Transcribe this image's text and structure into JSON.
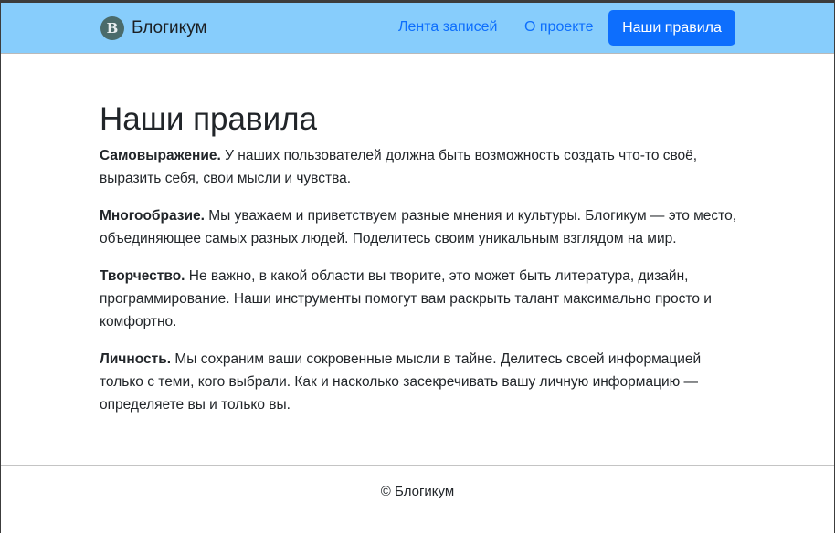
{
  "header": {
    "brand_letter": "B",
    "brand_name": "Блогикум",
    "nav": {
      "feed": "Лента записей",
      "about": "О проекте",
      "rules": "Наши правила"
    },
    "colors": {
      "navbar_bg": "#87cdfc",
      "accent": "#0d6efd"
    }
  },
  "main": {
    "title": "Наши правила",
    "rules": [
      {
        "term": "Самовыражение.",
        "text": " У наших пользователей должна быть возможность создать что-то своё, выразить себя, свои мысли и чувства."
      },
      {
        "term": "Многообразие.",
        "text": " Мы уважаем и приветствуем разные мнения и культуры. Блогикум — это место, объединяющее самых разных людей. Поделитесь своим уникальным взглядом на мир."
      },
      {
        "term": "Творчество.",
        "text": " Не важно, в какой области вы творите, это может быть литература, дизайн, программирование. Наши инструменты помогут вам раскрыть талант максимально просто и комфортно."
      },
      {
        "term": "Личность.",
        "text": " Мы сохраним ваши сокровенные мысли в тайне. Делитесь своей информацией только с теми, кого выбрали. Как и насколько засекречивать вашу личную информацию — определяете вы и только вы."
      }
    ]
  },
  "footer": {
    "copyright": "© Блогикум"
  }
}
